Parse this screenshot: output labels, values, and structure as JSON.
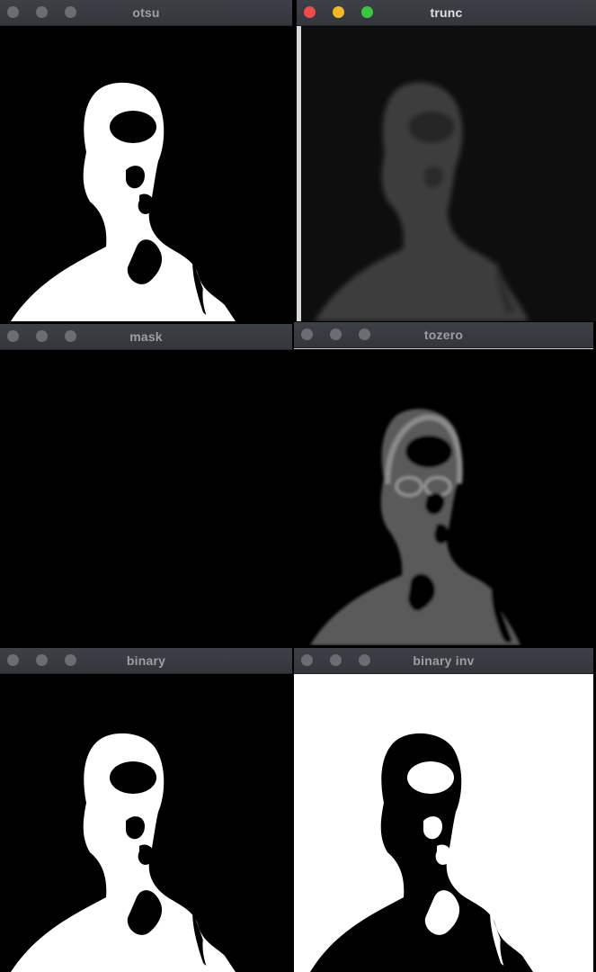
{
  "windows": [
    {
      "title": "otsu"
    },
    {
      "title": "trunc"
    },
    {
      "title": "mask"
    },
    {
      "title": "tozero"
    },
    {
      "title": "binary"
    },
    {
      "title": "binary inv"
    }
  ],
  "colors": {
    "titlebar": "#383c41",
    "title_inactive": "#9c9ea0",
    "title_active": "#dfe0e1",
    "close_active": "#ef4b4b",
    "minimize_active": "#f3b824",
    "maximize_active": "#3ac83f",
    "button_inactive": "#6b6d70"
  }
}
